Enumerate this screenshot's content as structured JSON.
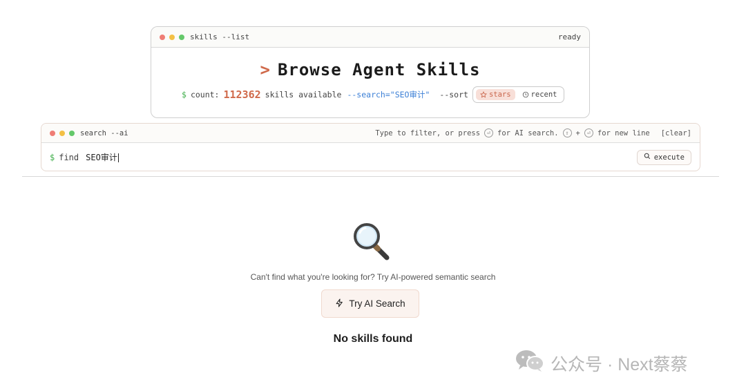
{
  "list_window": {
    "title": "skills --list",
    "status": "ready",
    "heading_prompt": ">",
    "heading": "Browse Agent Skills",
    "stats": {
      "dollar": "$",
      "count_label": "count:",
      "count_value": "112362",
      "available_label": "skills available",
      "search_flag": "--search=\"SEO审计\"",
      "sort_label": "--sort",
      "sort_options": [
        {
          "label": "stars",
          "icon": "star-icon",
          "active": true
        },
        {
          "label": "recent",
          "icon": "clock-icon",
          "active": false
        }
      ]
    }
  },
  "search_window": {
    "title": "search --ai",
    "hint_part1": "Type to filter, or press",
    "hint_part2": "for AI search.",
    "hint_plus": "+",
    "hint_part3": "for new line",
    "clear_label": "[clear]",
    "prompt_dollar": "$",
    "prompt_command": "find",
    "query": "SEO审计",
    "execute_label": "execute"
  },
  "empty_state": {
    "icon": "magnifier-emoji",
    "message": "Can't find what you're looking for? Try AI-powered semantic search",
    "ai_button_label": "Try AI Search",
    "title": "No skills found"
  },
  "watermark": {
    "text": "公众号 · Next蔡蔡"
  },
  "colors": {
    "accent": "#d06a4b",
    "prompt_green": "#3fae4a",
    "flag_blue": "#3b7fd6"
  }
}
